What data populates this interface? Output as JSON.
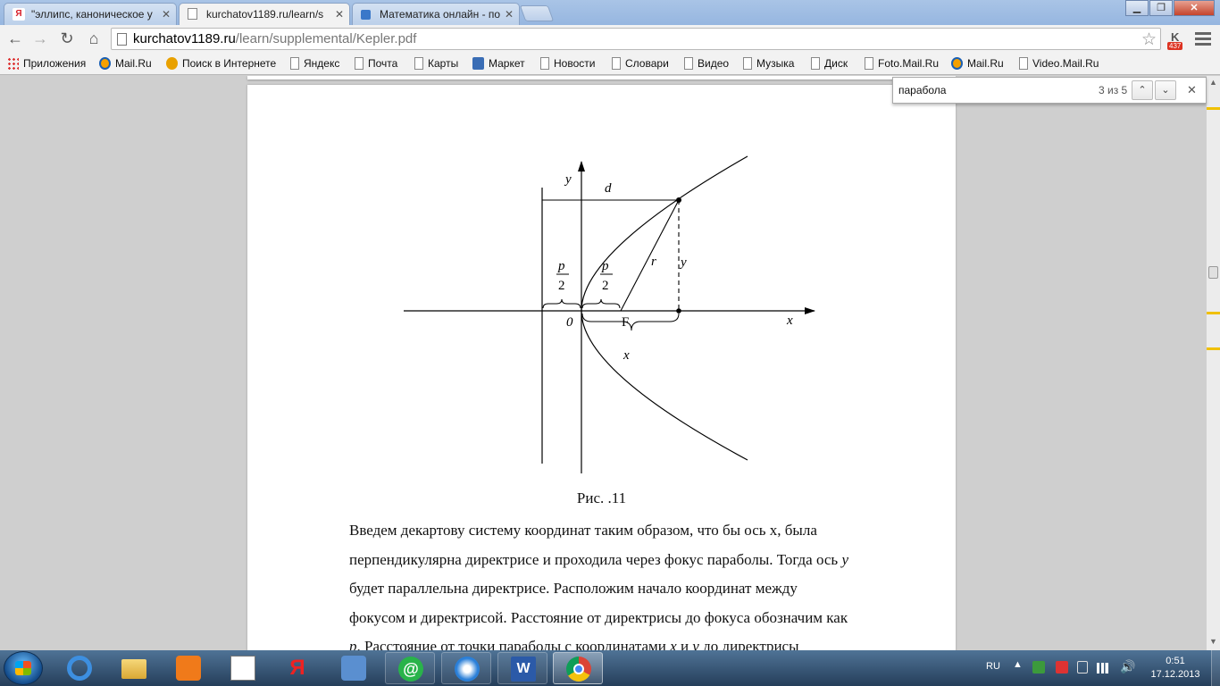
{
  "tabs": [
    {
      "title": "\"эллипс, каноническое у",
      "favicon": "Я",
      "favicon_color": "#d8202a"
    },
    {
      "title": "kurchatov1189.ru/learn/s",
      "favicon": "",
      "favicon_color": "#ffffff"
    },
    {
      "title": "Математика онлайн - по",
      "favicon": "",
      "favicon_color": "#3a78c9"
    }
  ],
  "toolbar": {
    "url_host": "kurchatov1189.ru",
    "url_path": "/learn/supplemental/Kepler.pdf",
    "ext_letter": "K",
    "ext_count": "437"
  },
  "bookmarks": [
    {
      "label": "Приложения",
      "icon": "apps-icon"
    },
    {
      "label": "Mail.Ru",
      "icon": "mailru-icon"
    },
    {
      "label": "Поиск в Интернете",
      "icon": "search-icon"
    },
    {
      "label": "Яндекс",
      "icon": "page-icon"
    },
    {
      "label": "Почта",
      "icon": "page-icon"
    },
    {
      "label": "Карты",
      "icon": "page-icon"
    },
    {
      "label": "Маркет",
      "icon": "market-icon"
    },
    {
      "label": "Новости",
      "icon": "page-icon"
    },
    {
      "label": "Словари",
      "icon": "page-icon"
    },
    {
      "label": "Видео",
      "icon": "page-icon"
    },
    {
      "label": "Музыка",
      "icon": "page-icon"
    },
    {
      "label": "Диск",
      "icon": "page-icon"
    },
    {
      "label": "Foto.Mail.Ru",
      "icon": "page-icon"
    },
    {
      "label": "Mail.Ru",
      "icon": "mailru-icon"
    },
    {
      "label": "Video.Mail.Ru",
      "icon": "page-icon"
    }
  ],
  "find": {
    "query": "парабола",
    "count": "3 из 5"
  },
  "figure": {
    "label_y_axis": "y",
    "label_x_axis": "x",
    "label_d": "d",
    "label_r": "r",
    "label_y_segment": "y",
    "label_p": "p",
    "label_2": "2",
    "label_origin": "0",
    "label_focus": "F",
    "label_x_brace": "x"
  },
  "caption": "Рис. .11",
  "paragraph": {
    "line1": "Введем декартову систему координат таким образом, что бы ось x, была",
    "line2a": "перпендикулярна директрисе и проходила через фокус параболы. Тогда ось ",
    "line2_var": "y",
    "line3": "будет параллельна директрисе. Расположим начало координат между",
    "line4": "фокусом и директрисой. Расстояние от директрисы до фокуса обозначим как",
    "line5_p": "p",
    "line5a": ". Расстояние от точки параболы с координатами ",
    "line5_x": "x",
    "line5b": " и ",
    "line5_y": "y",
    "line5c": " до директрисы"
  },
  "taskbar": {
    "lang": "RU",
    "time": "0:51",
    "date": "17.12.2013"
  }
}
